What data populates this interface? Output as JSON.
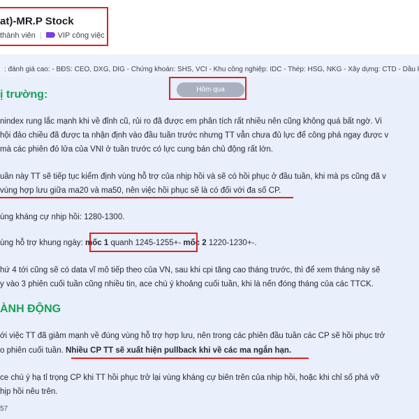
{
  "header": {
    "title": "at)-MR.P Stock",
    "members_label": "thành viên",
    "vip_label": "VIP công việc"
  },
  "sector_line": ": đánh giá cao: - BĐS: CEO, DXG, DIG - Chứng khoán: SHS, VCI - Khu công nghiệp: IDC - Thép: HSG, NKG - Xây dựng: CTD - Dầu k",
  "section1_heading": "ị trường:",
  "button_label": "Hôm qua",
  "paragraphs": {
    "p1_l1": "nindex rung lắc mạnh khi về đỉnh cũ, rủi ro đã được em phân tích rất nhiều nên cũng không quá bất ngờ. Vi",
    "p1_l2": "hội đảo chiều đã được ta nhận định vào đầu tuần trước nhưng TT vẫn chưa đủ lực để công phá ngay được v",
    "p1_l3": "mà các phiên đỏ lửa của VNI ở tuần trước có lực cung bán chủ động rất lớn.",
    "p2_l1": "uần này TT sẽ tiếp tục kiểm định vùng hỗ trợ của nhịp hồi và sẽ có hồi phục ở đầu tuần, khi mà ps cũng đã v",
    "p2_l2": "vùng hợp lưu giữa ma20 và ma50, nên việc hồi phục sẽ là có đối với đa số CP.",
    "p3": "ùng kháng cự nhịp hồi: 1280-1300.",
    "p4_pre": "ùng hỗ trợ khung ngày:",
    "p4_mark1": "mốc 1",
    "p4_mid": "quanh 1245-1255+-",
    "p4_mark2": "mốc 2",
    "p4_post": "1220-1230+-.",
    "p5_l1": "hứ 4 tới cũng sẽ có data vĩ mô tiếp theo của VN, sau khi cpi tăng cao tháng trước, thì để xem tháng này sẽ",
    "p5_l2": "y vào 3 phiên cuối tuần cũng nhiều tin, ace chú ý khoảng cuối tuần, khi là nến đóng tháng của các TTCK.",
    "p6_l1": "ới việc TT đã giảm mạnh về đúng vùng hỗ trợ hợp lưu, nên trong các phiên đầu tuần các CP sẽ hồi phục trở",
    "p6_l2_pre": "o phiên cuối tuần.",
    "p6_l2_bold": "Nhiều CP TT sẽ xuất hiện pullback khi về các ma ngắn hạn.",
    "p7_l1": "ce chú ý hạ tỉ trọng CP khi TT hồi phục trở lại vùng kháng cự biên trên của nhịp hồi, hoặc khi chỉ số phá vỡ",
    "p7_l2": "hịp hồi nêu trên.",
    "footer_num": "57"
  },
  "section2_heading": "ÀNH ĐỘNG",
  "colors": {
    "accent_green": "#18a058",
    "highlight_red": "#e02020",
    "vip_purple": "#7b3fe4",
    "button_gray": "#a9b1c1"
  }
}
